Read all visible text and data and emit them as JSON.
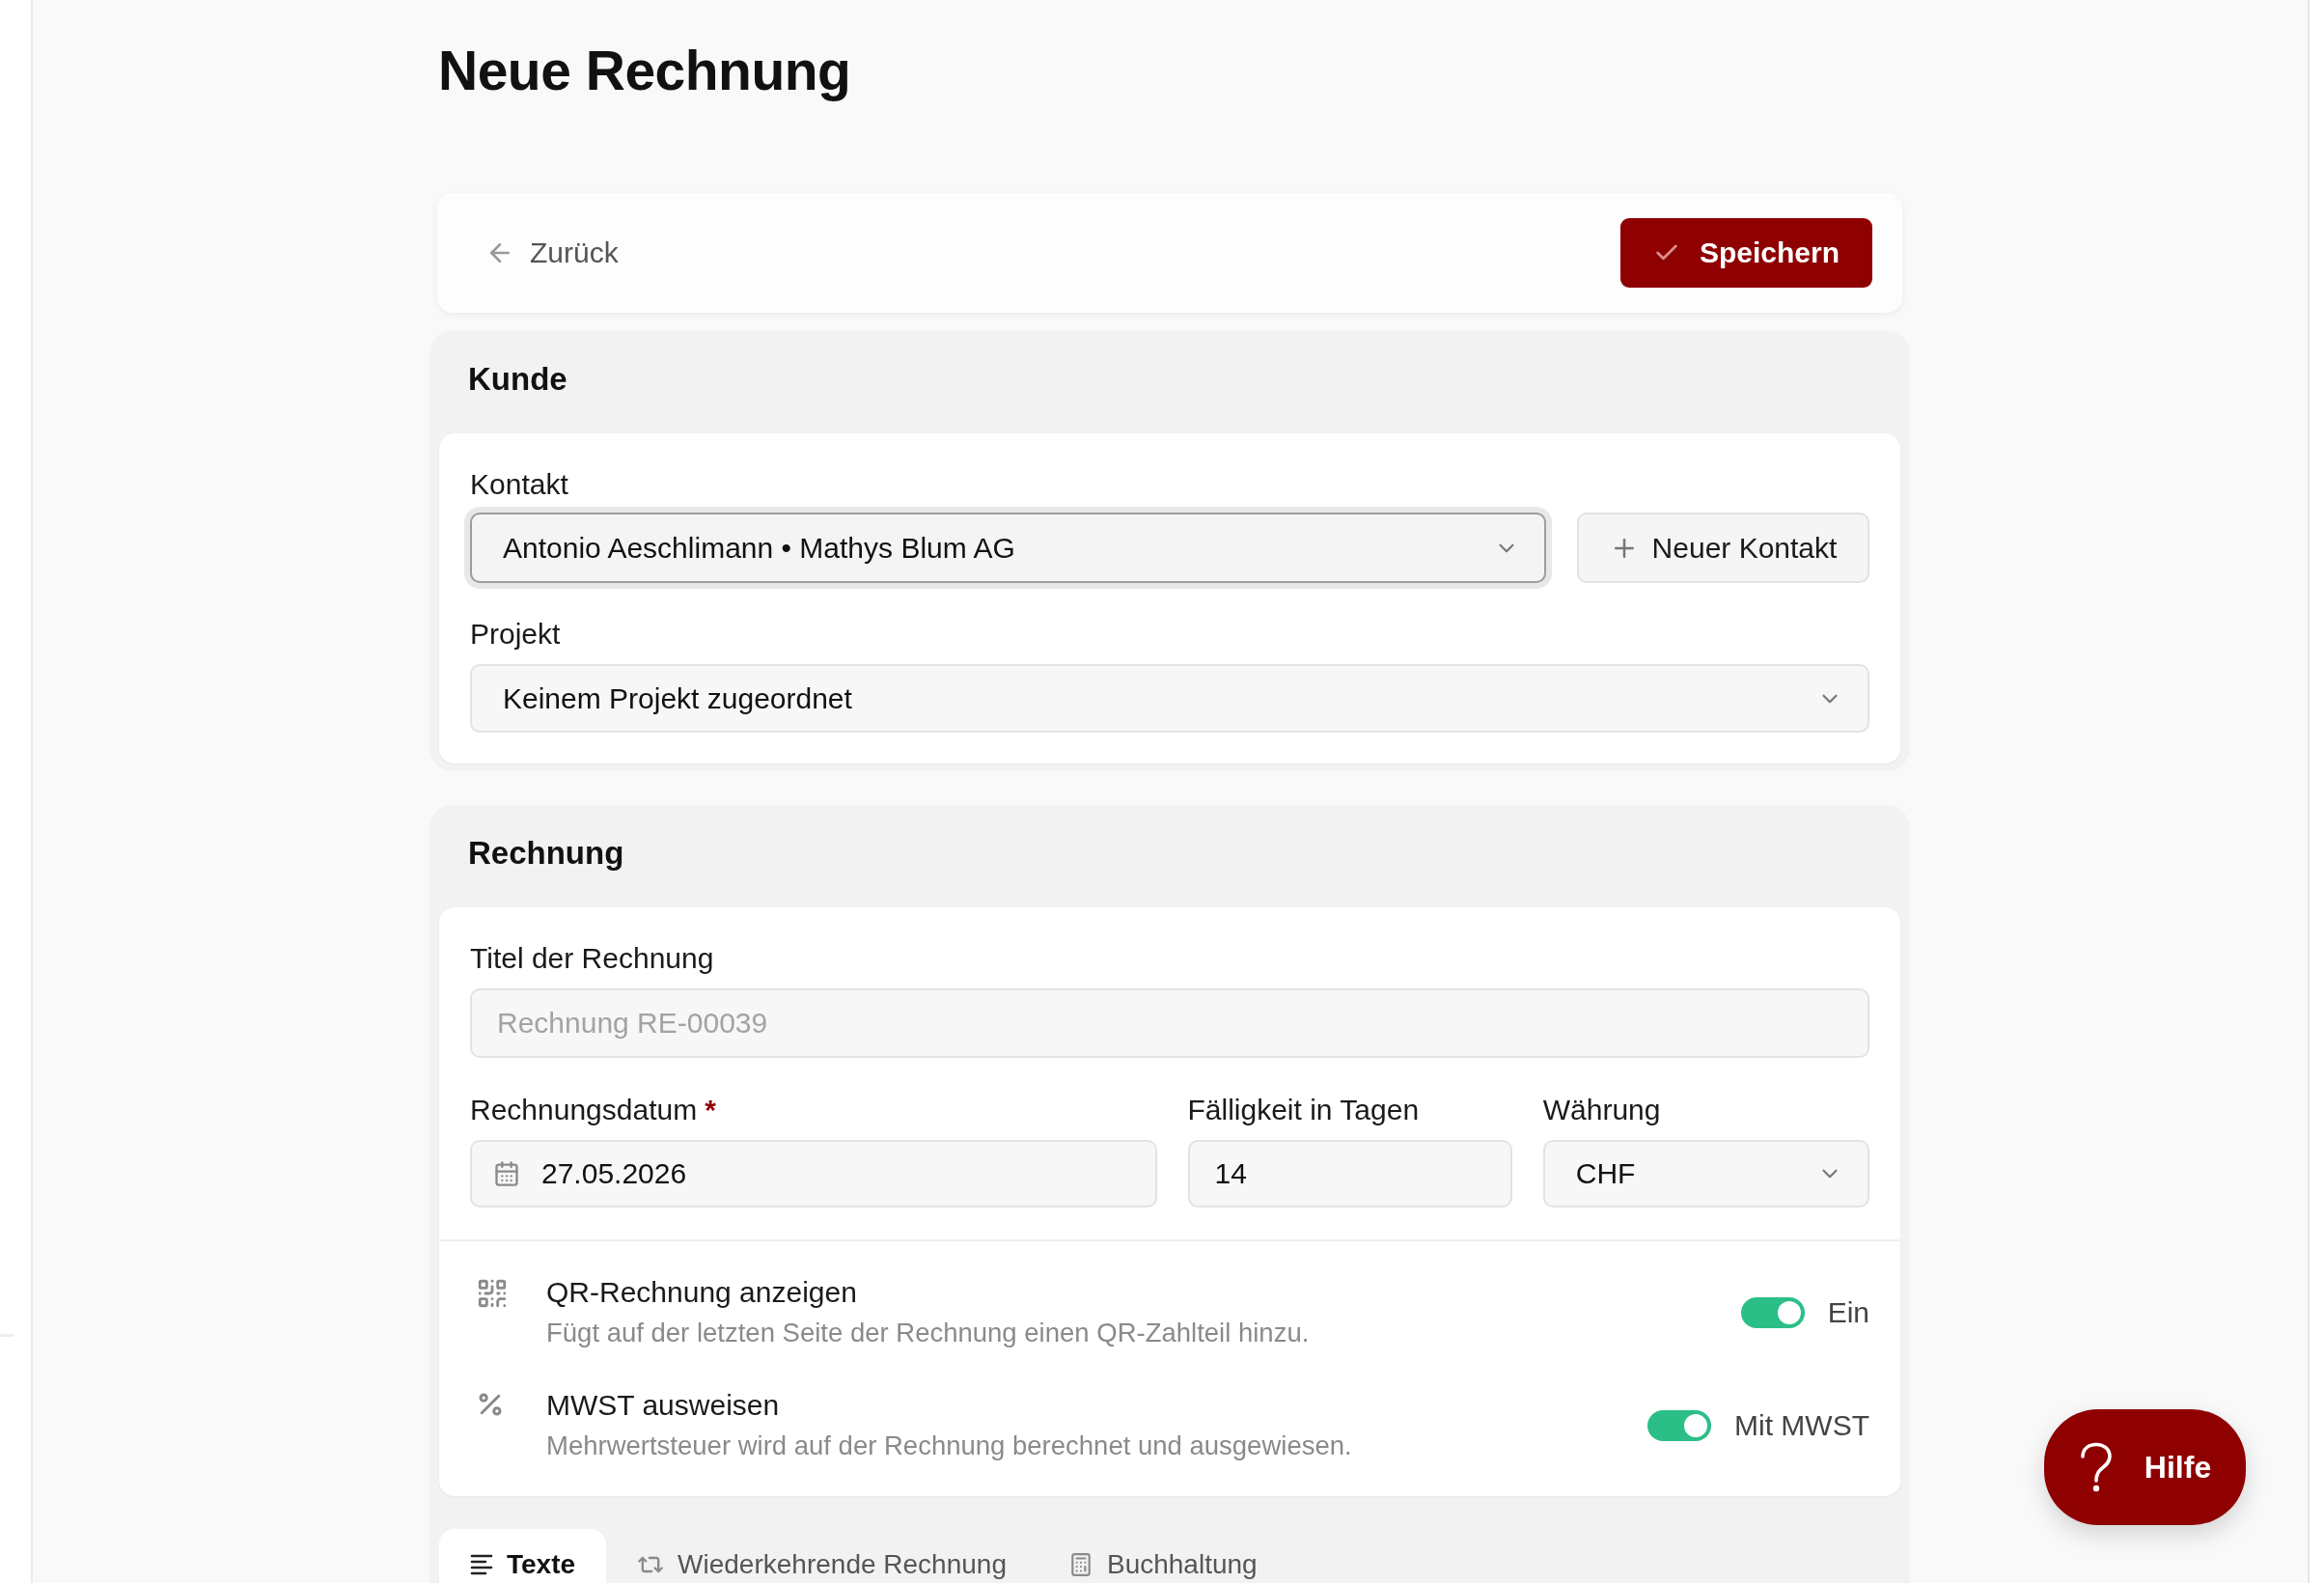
{
  "page": {
    "title": "Neue Rechnung"
  },
  "toolbar": {
    "back_label": "Zurück",
    "save_label": "Speichern"
  },
  "customer_section": {
    "heading": "Kunde",
    "contact": {
      "label": "Kontakt",
      "value": "Antonio Aeschlimann • Mathys Blum AG",
      "focused": true
    },
    "new_contact_label": "Neuer Kontakt",
    "project": {
      "label": "Projekt",
      "value": "Keinem Projekt zugeordnet",
      "focused": false
    }
  },
  "invoice_section": {
    "heading": "Rechnung",
    "title_field": {
      "label": "Titel der Rechnung",
      "placeholder": "Rechnung RE-00039"
    },
    "date_field": {
      "label": "Rechnungsdatum",
      "required_mark": "*",
      "value": "27.05.2026"
    },
    "due_days_field": {
      "label": "Fälligkeit in Tagen",
      "value": "14"
    },
    "currency_field": {
      "label": "Währung",
      "value": "CHF"
    },
    "options": [
      {
        "kind": "qr",
        "title": "QR-Rechnung anzeigen",
        "description": "Fügt auf der letzten Seite der Rechnung einen QR-Zahlteil hinzu.",
        "on": true,
        "state_label": "Ein"
      },
      {
        "kind": "vat",
        "title": "MWST ausweisen",
        "description": "Mehrwertsteuer wird auf der Rechnung berechnet und ausgewiesen.",
        "on": true,
        "state_label": "Mit MWST"
      }
    ]
  },
  "tabs": [
    {
      "kind": "lines",
      "label": "Texte",
      "selected": true
    },
    {
      "kind": "repeat",
      "label": "Wiederkehrende Rechnung",
      "selected": false
    },
    {
      "kind": "calculator",
      "label": "Buchhaltung",
      "selected": false
    }
  ],
  "help_button": {
    "label": "Hilfe"
  }
}
